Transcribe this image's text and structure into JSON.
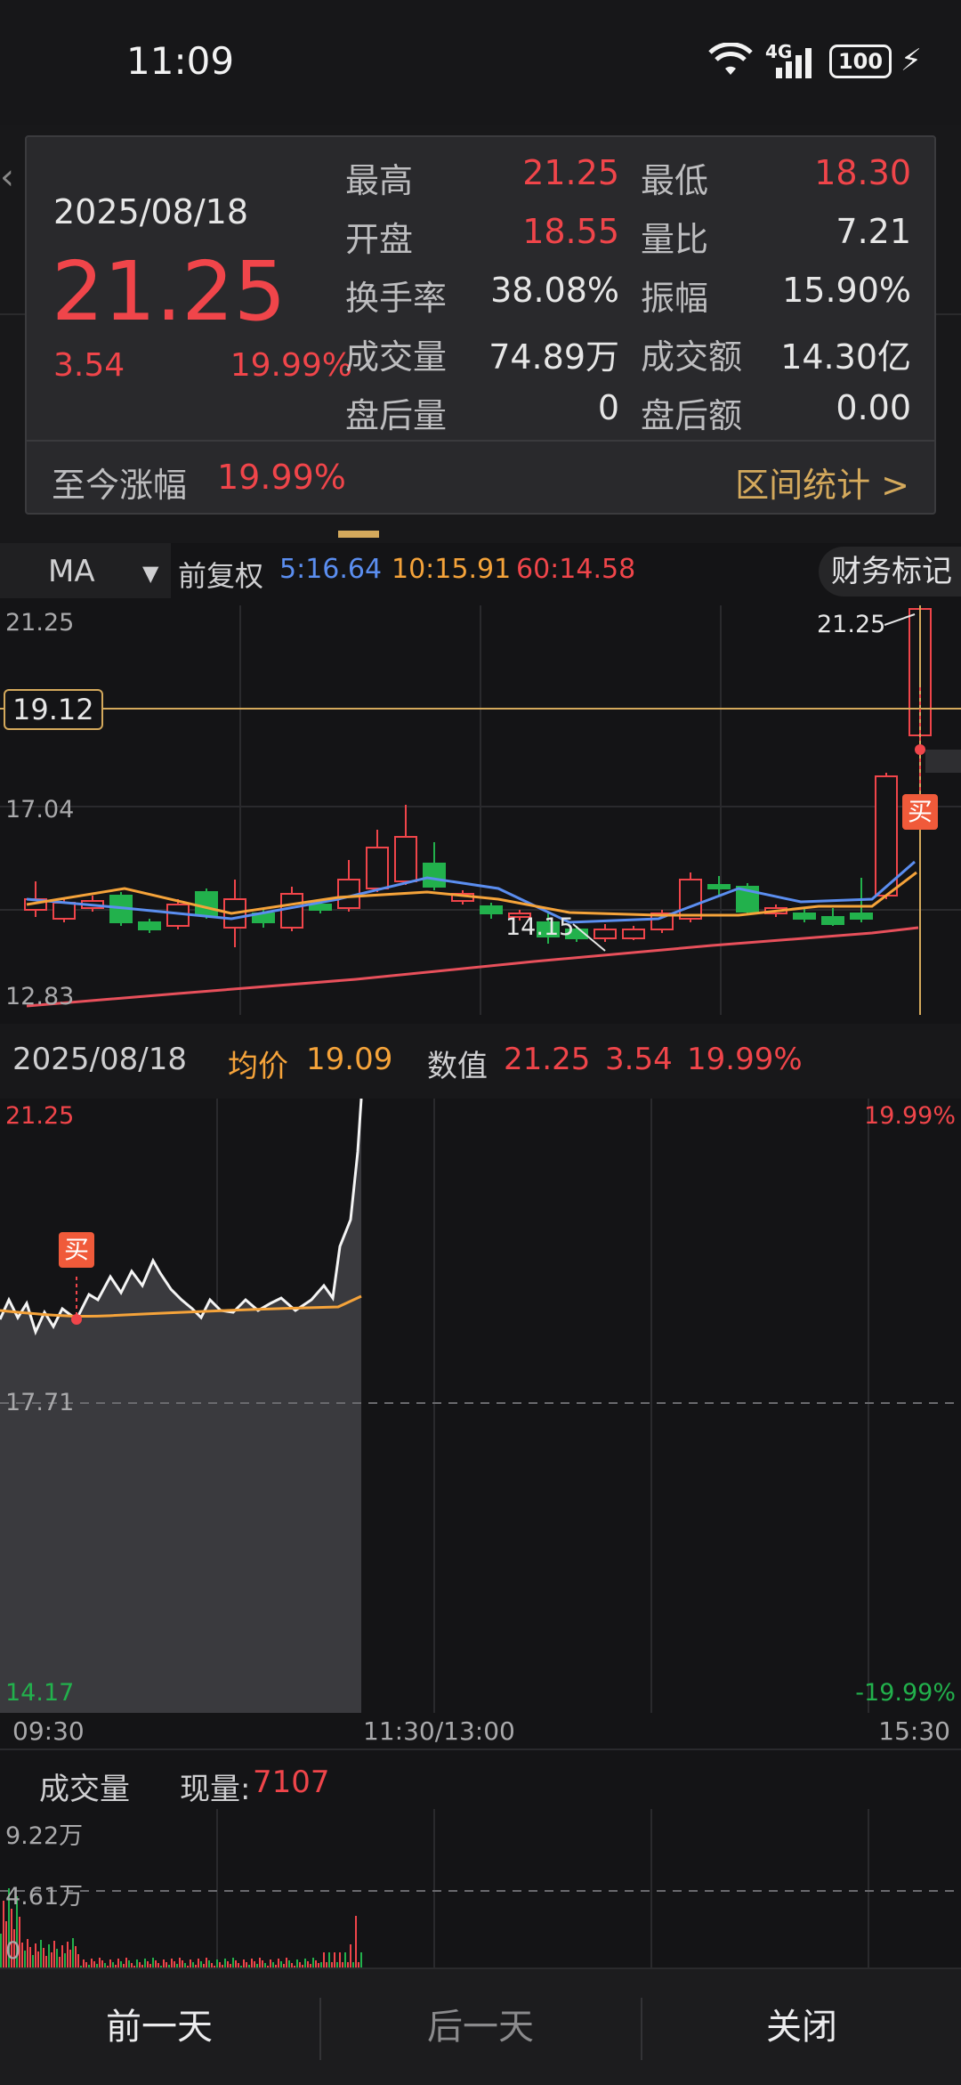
{
  "status_bar": {
    "time": "11:09",
    "battery": "100",
    "network": "4G"
  },
  "popup": {
    "date": "2025/08/18",
    "price": "21.25",
    "change": "3.54",
    "change_pct": "19.99%",
    "stats": [
      {
        "label": "最高",
        "value": "21.25",
        "color": "#f0454a"
      },
      {
        "label": "最低",
        "value": "18.30",
        "color": "#f0454a"
      },
      {
        "label": "开盘",
        "value": "18.55",
        "color": "#f0454a"
      },
      {
        "label": "量比",
        "value": "7.21",
        "color": "#e6e6e6"
      },
      {
        "label": "换手率",
        "value": "38.08%",
        "color": "#e6e6e6"
      },
      {
        "label": "振幅",
        "value": "15.90%",
        "color": "#e6e6e6"
      },
      {
        "label": "成交量",
        "value": "74.89万",
        "color": "#e6e6e6"
      },
      {
        "label": "成交额",
        "value": "14.30亿",
        "color": "#e6e6e6"
      },
      {
        "label": "盘后量",
        "value": "0",
        "color": "#e6e6e6"
      },
      {
        "label": "盘后额",
        "value": "0.00",
        "color": "#e6e6e6"
      }
    ],
    "footer_label": "至今涨幅",
    "footer_value": "19.99%",
    "range_stats": "区间统计 >"
  },
  "ma_bar": {
    "ma_select": "MA",
    "adjust": "前复权",
    "ma5": "5:16.64",
    "ma10": "10:15.91",
    "ma60": "60:14.58",
    "finance_mark": "财务标记"
  },
  "kchart": {
    "y_labels": [
      "21.25",
      "17.04",
      "12.83"
    ],
    "crosshair_price": "19.12",
    "high_annotation": "21.25",
    "low_annotation": "14.15",
    "buy_badge": "买",
    "colors": {
      "up": "#f0454a",
      "down": "#22b14c",
      "ma5": "#5b8ef0",
      "ma10": "#f5a33a",
      "ma60": "#e8505b"
    }
  },
  "intraday_header": {
    "date": "2025/08/18",
    "avg_label": "均价",
    "avg_value": "19.09",
    "value_label": "数值",
    "price": "21.25",
    "change": "3.54",
    "change_pct": "19.99%"
  },
  "intraday": {
    "price_high": "21.25",
    "price_mid": "17.71",
    "price_low": "14.17",
    "pct_high": "19.99%",
    "pct_low": "-19.99%",
    "buy_badge": "买"
  },
  "time_axis": {
    "start": "09:30",
    "mid": "11:30/13:00",
    "end": "15:30"
  },
  "volume": {
    "title": "成交量",
    "now_label": "现量:",
    "now_value": "7107",
    "y_labels": [
      "9.22万",
      "4.61万",
      "0"
    ]
  },
  "bottom_nav": {
    "prev": "前一天",
    "next": "后一天",
    "close": "关闭"
  }
}
